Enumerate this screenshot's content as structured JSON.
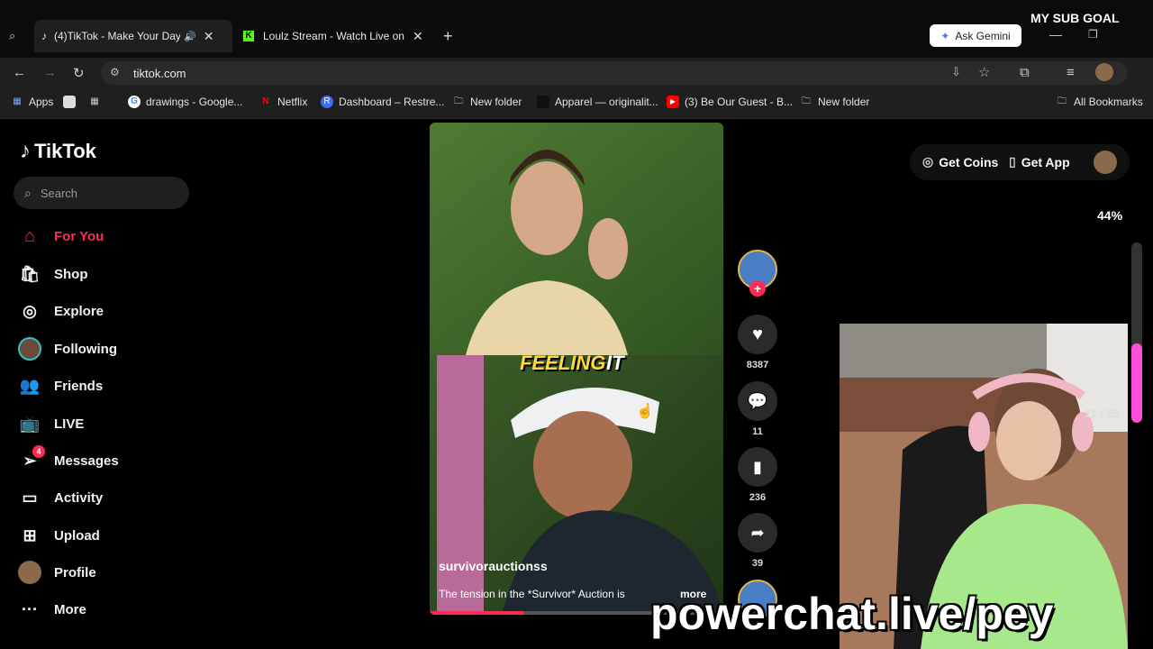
{
  "browser": {
    "tabs": [
      {
        "label": "(4)TikTok - Make Your Day"
      },
      {
        "label": "Loulz Stream - Watch Live on K"
      }
    ],
    "new_tab": "+",
    "ask_gemini": "Ask Gemini",
    "address": "tiktok.com",
    "bookmarks": [
      {
        "label": "Apps"
      },
      {
        "label": "drawings - Google..."
      },
      {
        "label": "Netflix"
      },
      {
        "label": "Dashboard – Restre..."
      },
      {
        "label": "New folder"
      },
      {
        "label": "Apparel — originalit..."
      },
      {
        "label": "(3) Be Our Guest - B..."
      },
      {
        "label": "New folder"
      },
      {
        "label": "All Bookmarks"
      }
    ]
  },
  "stream_overlay": {
    "sub_goal": "MY SUB GOAL",
    "progress_percent": 44,
    "progress_label": "44%",
    "counter": "11 / 25",
    "url": "powerchat.live/pey"
  },
  "tiktok": {
    "logo": "TikTok",
    "search_placeholder": "Search",
    "nav": [
      {
        "label": "For You",
        "icon": "home-icon",
        "active": true
      },
      {
        "label": "Shop",
        "icon": "shop-icon"
      },
      {
        "label": "Explore",
        "icon": "compass-icon"
      },
      {
        "label": "Following",
        "icon": "avatar-icon"
      },
      {
        "label": "Friends",
        "icon": "friends-icon"
      },
      {
        "label": "LIVE",
        "icon": "live-icon"
      },
      {
        "label": "Messages",
        "icon": "messages-icon",
        "badge": "4"
      },
      {
        "label": "Activity",
        "icon": "activity-icon"
      },
      {
        "label": "Upload",
        "icon": "upload-icon"
      },
      {
        "label": "Profile",
        "icon": "profile-icon"
      },
      {
        "label": "More",
        "icon": "more-icon"
      }
    ],
    "get_coins": "Get Coins",
    "get_app": "Get App",
    "video": {
      "caption_overlay_1": "FEELING",
      "caption_overlay_2": "IT",
      "author": "survivorauctionss",
      "description": "The tension in the *Survivor* Auction is",
      "more": "more",
      "likes": "8387",
      "comments": "11",
      "saves": "236",
      "shares": "39"
    }
  },
  "colors": {
    "accent": "#fe2c55",
    "progress": "#ff4fd8"
  }
}
